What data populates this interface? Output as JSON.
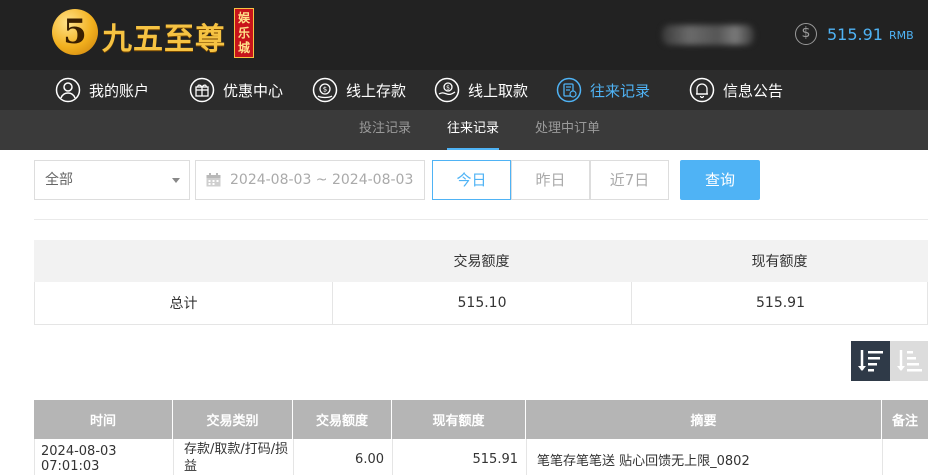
{
  "brand": {
    "logo_digit": "5",
    "logo_text": "九五至尊",
    "logo_badge": "娱乐城"
  },
  "account": {
    "balance": "515.91",
    "currency": "RMB"
  },
  "main_nav": [
    {
      "label": "我的账户",
      "icon": "user-icon",
      "active": false
    },
    {
      "label": "优惠中心",
      "icon": "gift-icon",
      "active": false
    },
    {
      "label": "线上存款",
      "icon": "deposit-icon",
      "active": false
    },
    {
      "label": "线上取款",
      "icon": "withdraw-icon",
      "active": false
    },
    {
      "label": "往来记录",
      "icon": "records-icon",
      "active": true
    },
    {
      "label": "信息公告",
      "icon": "bell-icon",
      "active": false
    }
  ],
  "sub_nav": [
    {
      "label": "投注记录",
      "active": false
    },
    {
      "label": "往来记录",
      "active": true
    },
    {
      "label": "处理中订单",
      "active": false
    }
  ],
  "filters": {
    "type_select": "全部",
    "date_range": "2024-08-03 ~ 2024-08-03",
    "quick_ranges": [
      {
        "label": "今日",
        "active": true
      },
      {
        "label": "昨日",
        "active": false
      },
      {
        "label": "近7日",
        "active": false
      }
    ],
    "query_label": "查询"
  },
  "summary": {
    "headers": [
      "",
      "交易额度",
      "现有额度"
    ],
    "row_label": "总计",
    "trade_amount": "515.10",
    "current_amount": "515.91"
  },
  "records": {
    "headers": [
      "时间",
      "交易类别",
      "交易额度",
      "现有额度",
      "摘要",
      "备注"
    ],
    "rows": [
      {
        "time": "2024-08-03 07:01:03",
        "category": "存款/取款/打码/损益",
        "amount": "6.00",
        "balance": "515.91",
        "summary": "笔笔存笔笔送 贴心回馈无上限_0802",
        "note": ""
      }
    ]
  },
  "colors": {
    "accent": "#4fb3f5",
    "brand_gold": "#f6c343",
    "header_bg": "#222222",
    "nav_bg": "#2c2c2c",
    "subnav_bg": "#3a3a3a"
  }
}
